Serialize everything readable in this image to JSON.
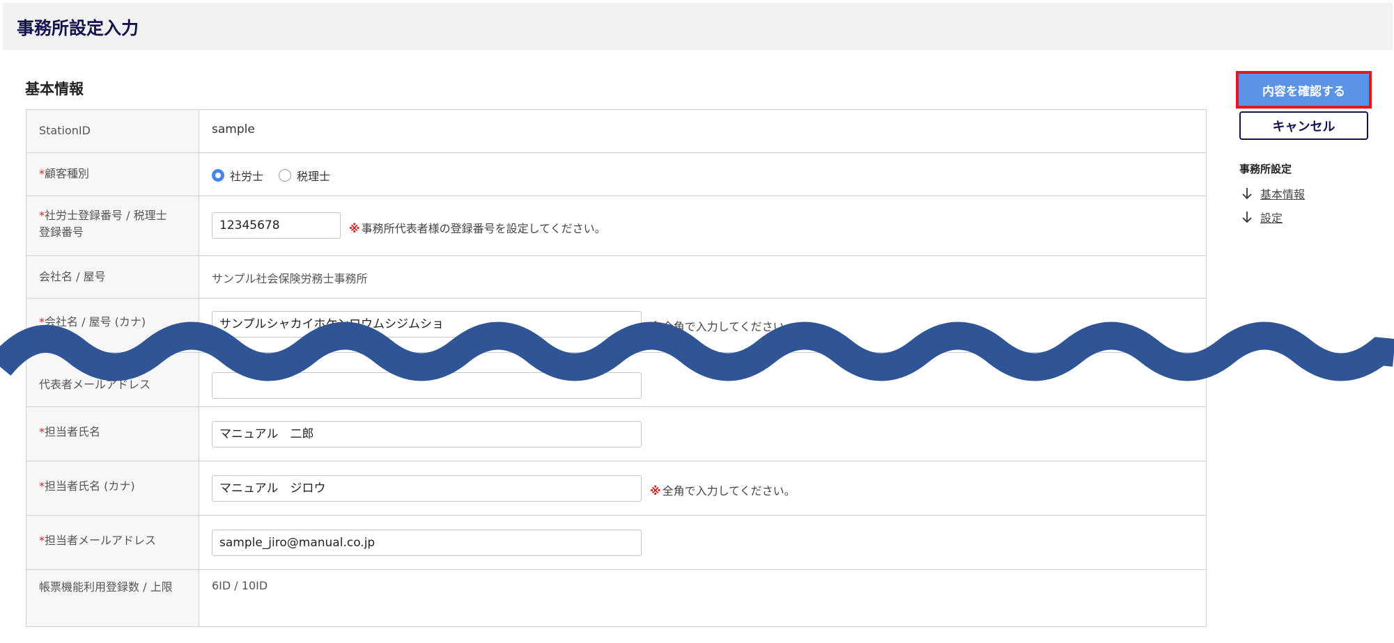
{
  "header": {
    "title": "事務所設定入力"
  },
  "section": {
    "title": "基本情報"
  },
  "required_mark": "*",
  "note_mark": "※",
  "form": {
    "station_id": {
      "label": "StationID",
      "value": "sample"
    },
    "customer_type": {
      "label": "顧客種別",
      "options": [
        {
          "label": "社労士",
          "selected": true
        },
        {
          "label": "税理士",
          "selected": false
        }
      ]
    },
    "registration_number": {
      "label_line1": "社労士登録番号 / 税理士",
      "label_line2": "登録番号",
      "value": "12345678",
      "note": "事務所代表者様の登録番号を設定してください。"
    },
    "company_name": {
      "label": "会社名 / 屋号",
      "value": "サンプル社会保険労務士事務所"
    },
    "company_name_kana": {
      "label": "会社名 / 屋号 (カナ)",
      "value": "サンプルシャカイホケンロウムシジムショ",
      "note": "全角で入力してください。"
    },
    "rep_email": {
      "label": "代表者メールアドレス",
      "value": ""
    },
    "contact_name": {
      "label": "担当者氏名",
      "value": "マニュアル　二郎"
    },
    "contact_name_kana": {
      "label": "担当者氏名 (カナ)",
      "value": "マニュアル　ジロウ",
      "note": "全角で入力してください。"
    },
    "contact_email": {
      "label": "担当者メールアドレス",
      "value": "sample_jiro@manual.co.jp"
    },
    "form_usage": {
      "label": "帳票機能利用登録数 / 上限",
      "value": "6ID / 10ID"
    }
  },
  "sidebar": {
    "confirm_label": "内容を確認する",
    "cancel_label": "キャンセル",
    "nav_title": "事務所設定",
    "links": [
      {
        "label": "基本情報",
        "icon": "arrow-down-icon"
      },
      {
        "label": "設定",
        "icon": "arrow-down-icon"
      }
    ]
  },
  "colors": {
    "title": "#13134f",
    "primary_button": "#5b93e6",
    "highlight_frame": "#e0191a",
    "wave": "#2f5597",
    "required": "#e02020"
  }
}
